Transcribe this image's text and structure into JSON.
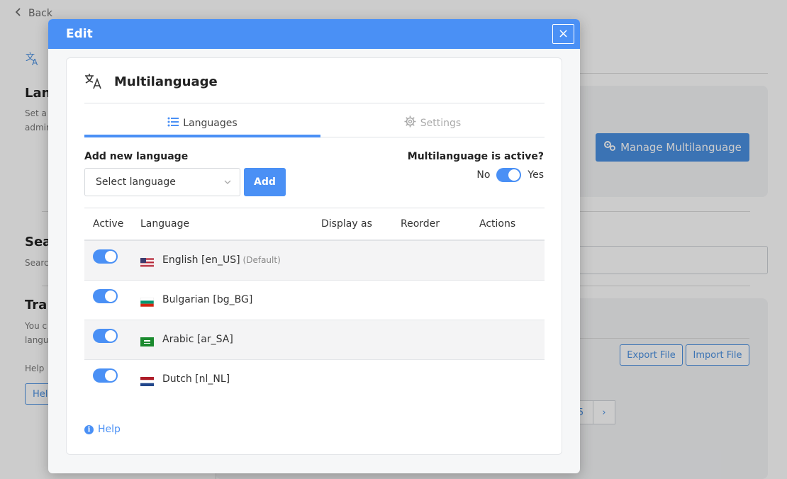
{
  "background": {
    "back_label": "Back",
    "sections": [
      {
        "title": "Lan",
        "desc_lines": [
          "Set a",
          "admin"
        ]
      },
      {
        "title": "Sea",
        "desc_lines": [
          "Searc"
        ]
      },
      {
        "title": "Tra",
        "desc_lines": [
          "You c",
          "langu",
          "",
          "Help"
        ]
      }
    ],
    "manage_button": "Manage Multilanguage",
    "export_button": "Export File",
    "import_button": "Import File",
    "help_button": "Help",
    "pagination": {
      "page": "5",
      "next": "›"
    }
  },
  "modal": {
    "title": "Edit",
    "close_label": "×",
    "panel_title": "Multilanguage",
    "tabs": [
      {
        "label": "Languages",
        "icon": "list-icon",
        "active": true
      },
      {
        "label": "Settings",
        "icon": "gear-icon",
        "active": false
      }
    ],
    "add_language": {
      "label": "Add new language",
      "select_placeholder": "Select language",
      "add_button": "Add"
    },
    "active_toggle": {
      "label": "Multilanguage is active?",
      "no": "No",
      "yes": "Yes",
      "value": true
    },
    "table": {
      "columns": [
        "Active",
        "Language",
        "Display as",
        "Reorder",
        "Actions"
      ],
      "rows": [
        {
          "active": true,
          "flag": "us-flag",
          "name": "English [en_US]",
          "tag": "(Default)"
        },
        {
          "active": true,
          "flag": "bg-flag",
          "name": "Bulgarian [bg_BG]",
          "tag": ""
        },
        {
          "active": true,
          "flag": "sa-flag",
          "name": "Arabic [ar_SA]",
          "tag": ""
        },
        {
          "active": true,
          "flag": "nl-flag",
          "name": "Dutch [nl_NL]",
          "tag": ""
        }
      ]
    },
    "help_label": "Help"
  },
  "colors": {
    "accent": "#4a90f5",
    "header": "#4a90f5",
    "muted": "#aaaaaa"
  }
}
